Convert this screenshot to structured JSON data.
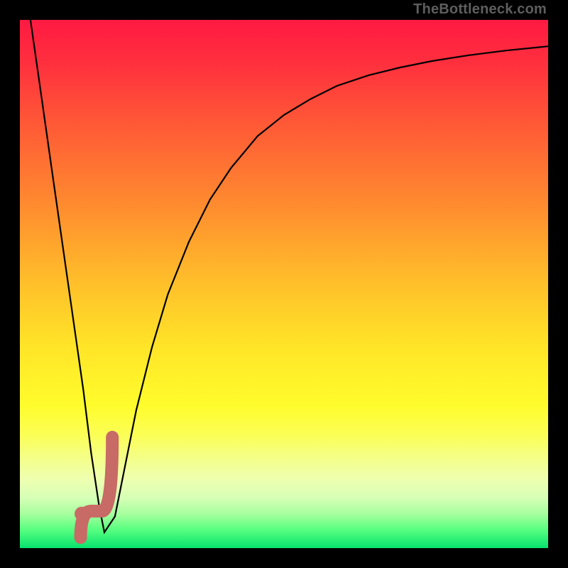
{
  "watermark": "TheBottleneck.com",
  "gradient": {
    "stops": [
      {
        "offset": 0.0,
        "color": "#ff1a42"
      },
      {
        "offset": 0.08,
        "color": "#ff2f3e"
      },
      {
        "offset": 0.2,
        "color": "#ff5a36"
      },
      {
        "offset": 0.35,
        "color": "#ff8b2f"
      },
      {
        "offset": 0.5,
        "color": "#ffc02a"
      },
      {
        "offset": 0.62,
        "color": "#ffe528"
      },
      {
        "offset": 0.73,
        "color": "#fffc2c"
      },
      {
        "offset": 0.785,
        "color": "#fbff55"
      },
      {
        "offset": 0.83,
        "color": "#f4ff89"
      },
      {
        "offset": 0.87,
        "color": "#eeffb0"
      },
      {
        "offset": 0.905,
        "color": "#d6ffb6"
      },
      {
        "offset": 0.935,
        "color": "#a7ff9e"
      },
      {
        "offset": 0.965,
        "color": "#58ff80"
      },
      {
        "offset": 1.0,
        "color": "#06e26e"
      }
    ]
  },
  "chart_data": {
    "type": "line",
    "title": "",
    "xlabel": "",
    "ylabel": "",
    "xlim": [
      0,
      100
    ],
    "ylim": [
      0,
      100
    ],
    "series": [
      {
        "name": "curve",
        "x": [
          2,
          4,
          6,
          8,
          10,
          12,
          13.5,
          15,
          16,
          18,
          20,
          22,
          25,
          28,
          32,
          36,
          40,
          45,
          50,
          55,
          60,
          66,
          72,
          78,
          85,
          92,
          100
        ],
        "values": [
          100,
          86,
          72,
          58,
          44,
          30,
          18,
          8,
          3,
          6,
          16,
          26,
          38,
          48,
          58,
          66,
          72,
          78,
          82,
          85,
          87.5,
          89.5,
          91,
          92.2,
          93.3,
          94.2,
          95
        ]
      }
    ],
    "marker": {
      "name": "j-marker",
      "x_start": 11.5,
      "y_tip": 2,
      "x_turn": 15.5,
      "y_base": 7,
      "x_end": 17.5,
      "y_end": 21
    },
    "dot": {
      "x": 11.7,
      "y": 6.5
    },
    "colors": {
      "curve": "#000000",
      "marker": "#c86a65",
      "dot": "#c86a65"
    }
  }
}
